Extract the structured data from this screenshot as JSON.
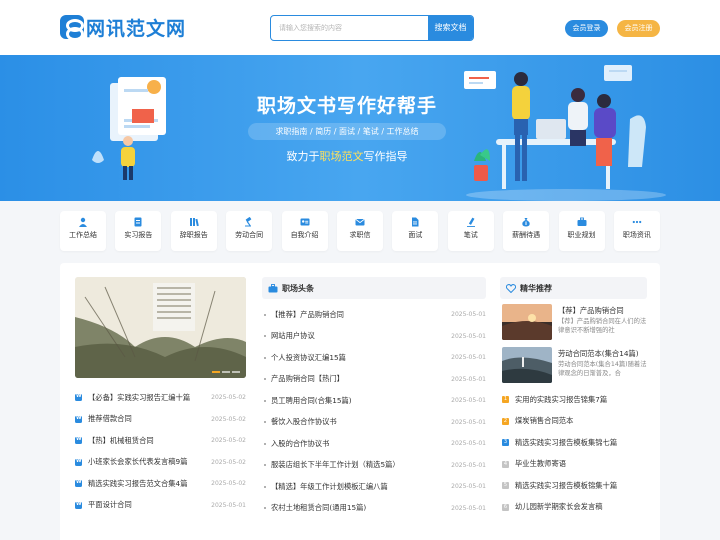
{
  "brand": {
    "name": "网讯范文网",
    "color": "#1e7fd6"
  },
  "search": {
    "placeholder": "请输入您搜索的内容",
    "button": "搜索文档"
  },
  "auth": {
    "login": "会员登录",
    "register": "会员注册"
  },
  "banner": {
    "title": "职场文书写作好帮手",
    "subtitle": "求职指南 / 简历 / 面试 / 笔试 / 工作总结",
    "slogan_prefix": "致力于",
    "slogan_highlight": "职场范文",
    "slogan_suffix": "写作指导"
  },
  "categories": [
    {
      "label": "工作总结",
      "icon": "person-icon"
    },
    {
      "label": "实习报告",
      "icon": "report-icon"
    },
    {
      "label": "辞职报告",
      "icon": "books-icon"
    },
    {
      "label": "劳动合同",
      "icon": "gavel-icon"
    },
    {
      "label": "自我介绍",
      "icon": "id-card-icon"
    },
    {
      "label": "求职信",
      "icon": "envelope-icon"
    },
    {
      "label": "面试",
      "icon": "document-icon"
    },
    {
      "label": "笔试",
      "icon": "pen-icon"
    },
    {
      "label": "薪酬待遇",
      "icon": "money-bag-icon"
    },
    {
      "label": "职业规划",
      "icon": "briefcase-icon"
    },
    {
      "label": "职场资讯",
      "icon": "ellipsis-icon"
    }
  ],
  "left_list": [
    {
      "title": "【必备】实践实习报告汇编十篇",
      "date": "2025-05-02"
    },
    {
      "title": "推荐借款合同",
      "date": "2025-05-02"
    },
    {
      "title": "【热】机械租赁合同",
      "date": "2025-05-02"
    },
    {
      "title": "小班家长会家长代表发言稿9篇",
      "date": "2025-05-02"
    },
    {
      "title": "精选实践实习报告范文合集4篇",
      "date": "2025-05-02"
    },
    {
      "title": "平面设计合同",
      "date": "2025-05-01"
    }
  ],
  "middle": {
    "heading": "职场头条",
    "items": [
      {
        "title": "【推荐】产品购销合同",
        "date": "2025-05-01"
      },
      {
        "title": "网站用户协议",
        "date": "2025-05-01"
      },
      {
        "title": "个人投资协议汇编15篇",
        "date": "2025-05-01"
      },
      {
        "title": "产品购销合同【热门】",
        "date": "2025-05-01"
      },
      {
        "title": "员工聘用合同(合集15篇)",
        "date": "2025-05-01"
      },
      {
        "title": "餐饮入股合作协议书",
        "date": "2025-05-01"
      },
      {
        "title": "入股的合作协议书",
        "date": "2025-05-01"
      },
      {
        "title": "服装店组长下半年工作计划（精选5篇）",
        "date": "2025-05-01"
      },
      {
        "title": "【精选】年级工作计划模板汇编八篇",
        "date": "2025-05-01"
      },
      {
        "title": "农村土地租赁合同(通用15篇)",
        "date": "2025-05-01"
      }
    ]
  },
  "right": {
    "heading": "精华推荐",
    "cards": [
      {
        "title": "【荐】产品购销合同",
        "desc": "【荐】产品购销合同在人们的法律意识不断增强的社"
      },
      {
        "title": "劳动合同范本(集合14篇)",
        "desc": "劳动合同范本(集合14篇)随着法律观念的日渐普及，合"
      }
    ],
    "ranked": [
      {
        "num": "1",
        "title": "实用的实践实习报告锦集7篇",
        "color": "#f5a623"
      },
      {
        "num": "2",
        "title": "煤炭销售合同范本",
        "color": "#f5a623"
      },
      {
        "num": "3",
        "title": "精选实践实习报告模板集锦七篇",
        "color": "#2a8bdf"
      },
      {
        "num": "4",
        "title": "毕业生教师寄语",
        "color": "#c4c4c4"
      },
      {
        "num": "5",
        "title": "精选实践实习报告模板锦集十篇",
        "color": "#c4c4c4"
      },
      {
        "num": "6",
        "title": "幼儿园新学期家长会发言稿",
        "color": "#c4c4c4"
      }
    ]
  }
}
